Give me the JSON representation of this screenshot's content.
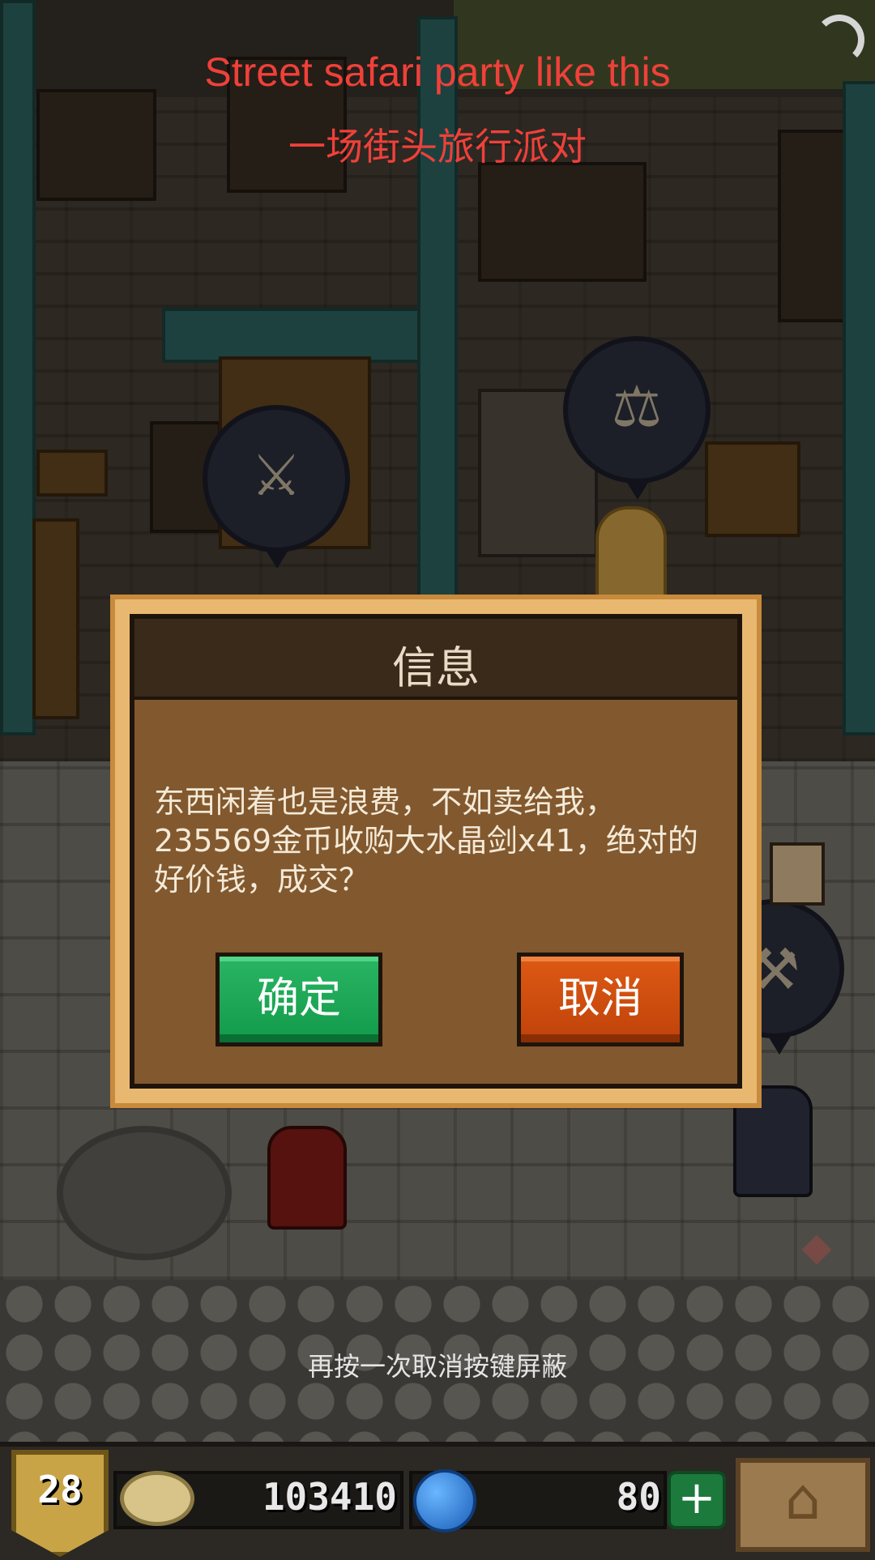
{
  "overlay": {
    "title_en": "Street safari party like this",
    "title_cn": "一场街头旅行派对"
  },
  "dialog": {
    "title": "信息",
    "message": "东西闲着也是浪费，不如卖给我，235569金币收购大水晶剑x41，绝对的好价钱，成交？",
    "confirm_label": "确定",
    "cancel_label": "取消"
  },
  "toast": {
    "text": "再按一次取消按键屏蔽"
  },
  "hud": {
    "level": "28",
    "coins": "103410",
    "gems": "80",
    "add_label": "+"
  },
  "icons": [
    "loading-icon",
    "sword-bubble-icon",
    "scales-bubble-icon",
    "hammer-bubble-icon",
    "coin-icon",
    "gem-icon",
    "home-icon"
  ],
  "colors": {
    "title_red": "#f0403a",
    "confirm_green": "#129a4a",
    "cancel_orange": "#c0420a",
    "dialog_brown": "#82582e",
    "dialog_frame": "#e9b870"
  }
}
